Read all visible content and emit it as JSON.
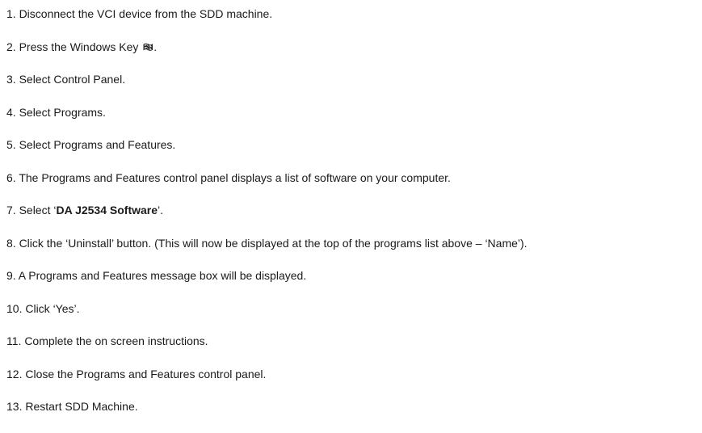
{
  "steps": [
    {
      "text": "1. Disconnect the VCI device from the SDD machine."
    },
    {
      "before": "2. Press the Windows Key ",
      "icon": "windows-key-icon",
      "after": "."
    },
    {
      "text": "3. Select Control Panel."
    },
    {
      "text": "4. Select Programs."
    },
    {
      "text": "5. Select Programs and Features."
    },
    {
      "text": "6. The Programs and Features control panel displays a list of software on your computer."
    },
    {
      "before": "7. Select ‘",
      "bold": "DA J2534 Software",
      "after": "’."
    },
    {
      "text": "8. Click the ‘Uninstall’ button. (This will now be displayed at the top of the programs list above – ‘Name’)."
    },
    {
      "text": "9. A Programs and Features message box will be displayed."
    },
    {
      "text": "10. Click ‘Yes’."
    },
    {
      "text": "11. Complete the on screen instructions."
    },
    {
      "text": "12. Close the Programs and Features control panel."
    },
    {
      "text": "13. Restart SDD Machine."
    }
  ]
}
